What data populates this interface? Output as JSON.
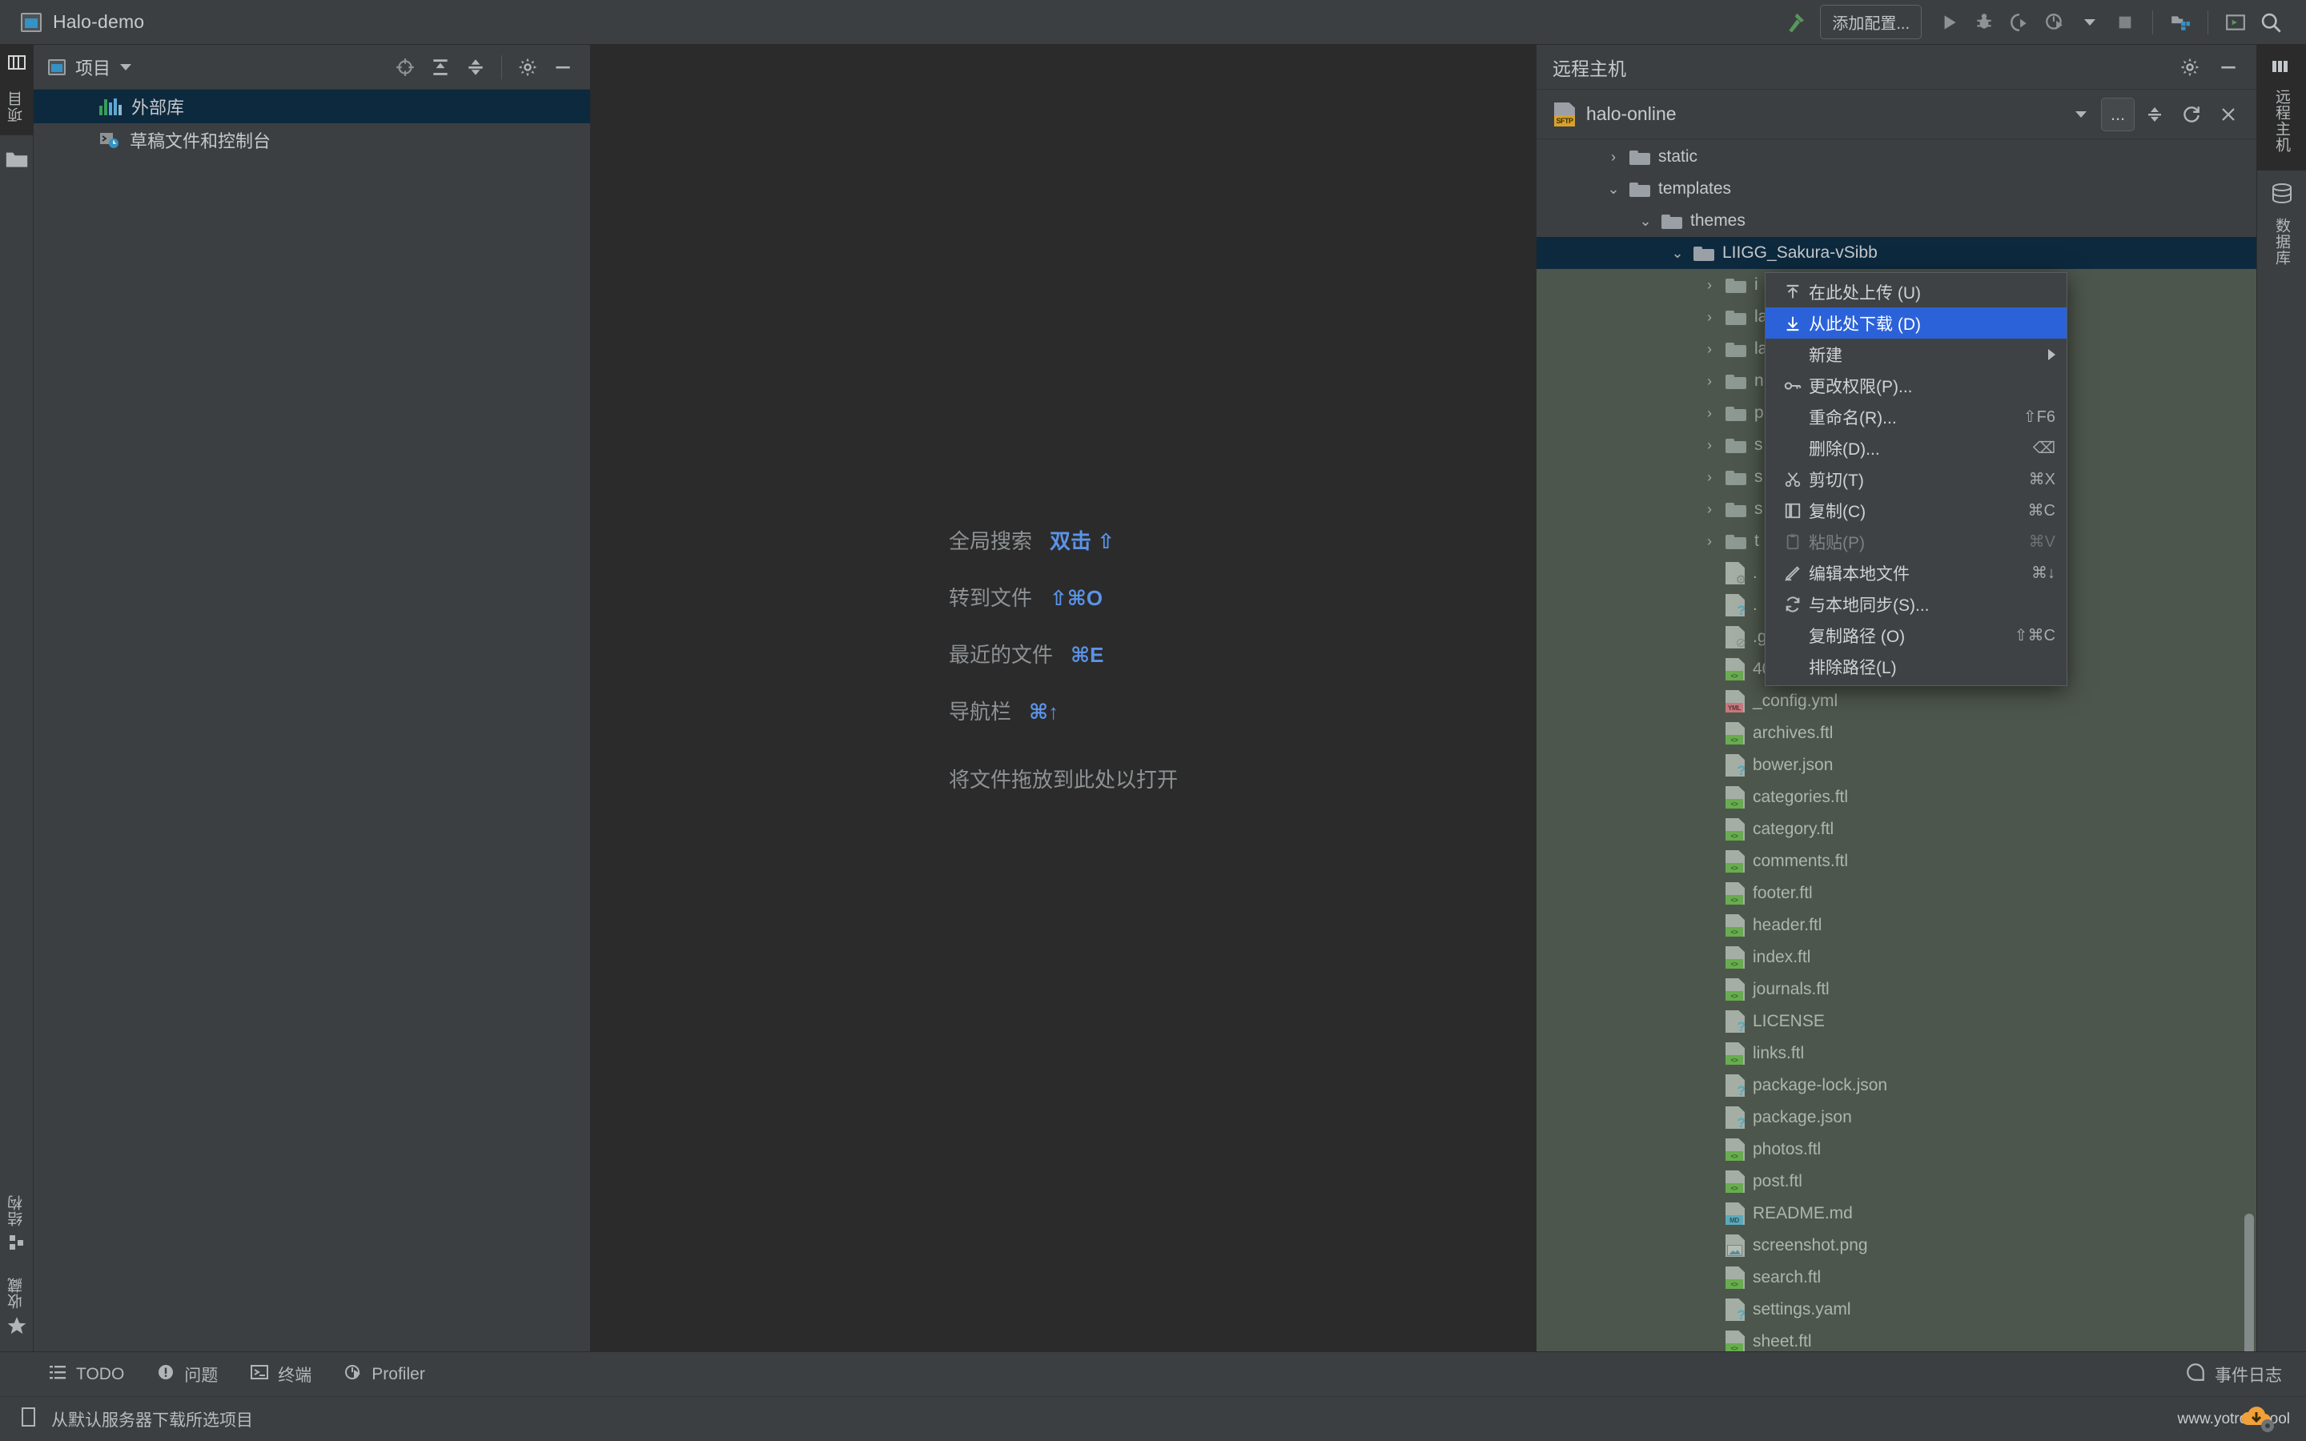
{
  "titlebar": {
    "project_name": "Halo-demo",
    "run_config_label": "添加配置...",
    "icons": [
      "hammer-icon",
      "run-icon",
      "debug-icon",
      "run-coverage-icon",
      "profile-icon",
      "dropdown-icon",
      "stop-icon",
      "git-icon",
      "terminal-icon",
      "search-everywhere-icon"
    ]
  },
  "left_strip": {
    "top_labels": [
      "项目"
    ],
    "bottom_items": [
      {
        "label": "结构",
        "icon": "structure-icon"
      },
      {
        "label": "收藏",
        "icon": "star-icon"
      }
    ],
    "folder_icon": "folder-icon"
  },
  "project_panel": {
    "title": "项目",
    "toolbar_icons": [
      "select-opened-file-icon",
      "expand-all-icon",
      "collapse-all-icon",
      "gear-icon",
      "hide-icon"
    ],
    "tree": [
      {
        "label": "外部库",
        "icon": "library-bars-icon",
        "selected": true
      },
      {
        "label": "草稿文件和控制台",
        "icon": "scratches-icon",
        "selected": false
      }
    ]
  },
  "editor": {
    "hints": [
      {
        "action": "全局搜索",
        "keys": "双击 ⇧"
      },
      {
        "action": "转到文件",
        "keys": "⇧⌘O"
      },
      {
        "action": "最近的文件",
        "keys": "⌘E"
      },
      {
        "action": "导航栏",
        "keys": "⌘↑"
      }
    ],
    "drop_hint": "将文件拖放到此处以打开"
  },
  "remote_panel": {
    "title": "远程主机",
    "header_icons": [
      "gear-icon",
      "hide-icon"
    ],
    "connection": "halo-online",
    "connection_icon": "sftp-icon",
    "toolbar_icons": [
      "dropdown-icon",
      "more-icon",
      "collapse-all-icon",
      "refresh-icon",
      "close-icon"
    ],
    "more_label": "...",
    "tree": [
      {
        "name": "static",
        "type": "folder",
        "chevron": "›",
        "indent": 1,
        "selected": false
      },
      {
        "name": "templates",
        "type": "folder",
        "chevron": "⌄",
        "indent": 1,
        "selected": false
      },
      {
        "name": "themes",
        "type": "folder",
        "chevron": "⌄",
        "indent": 2,
        "selected": false
      },
      {
        "name": "LIIGG_Sakura-vSibb",
        "type": "folder",
        "chevron": "⌄",
        "indent": 3,
        "selected": true
      },
      {
        "name": "i",
        "type": "folder",
        "chevron": "›",
        "indent": 4,
        "selected": false
      },
      {
        "name": "la",
        "type": "folder",
        "chevron": "›",
        "indent": 4,
        "selected": false
      },
      {
        "name": "la",
        "type": "folder",
        "chevron": "›",
        "indent": 4,
        "selected": false
      },
      {
        "name": "n",
        "type": "folder",
        "chevron": "›",
        "indent": 4,
        "selected": false
      },
      {
        "name": "p",
        "type": "folder",
        "chevron": "›",
        "indent": 4,
        "selected": false
      },
      {
        "name": "s",
        "type": "folder",
        "chevron": "›",
        "indent": 4,
        "selected": false
      },
      {
        "name": "s",
        "type": "folder",
        "chevron": "›",
        "indent": 4,
        "selected": false
      },
      {
        "name": "s",
        "type": "folder",
        "chevron": "›",
        "indent": 4,
        "selected": false
      },
      {
        "name": "t",
        "type": "folder",
        "chevron": "›",
        "indent": 4,
        "selected": false
      },
      {
        "name": ".",
        "type": "file",
        "badge": "config",
        "indent": 4,
        "selected": false
      },
      {
        "name": ".",
        "type": "file",
        "badge": "unknown",
        "indent": 4,
        "selected": false
      },
      {
        "name": ".g",
        "type": "file",
        "badge": "ignore",
        "indent": 4,
        "selected": false
      },
      {
        "name": "404.ftl",
        "type": "file",
        "badge": "ftl",
        "indent": 4,
        "selected": false
      },
      {
        "name": "_config.yml",
        "type": "file",
        "badge": "yml",
        "indent": 4,
        "selected": false
      },
      {
        "name": "archives.ftl",
        "type": "file",
        "badge": "ftl",
        "indent": 4,
        "selected": false
      },
      {
        "name": "bower.json",
        "type": "file",
        "badge": "unknown",
        "indent": 4,
        "selected": false
      },
      {
        "name": "categories.ftl",
        "type": "file",
        "badge": "ftl",
        "indent": 4,
        "selected": false
      },
      {
        "name": "category.ftl",
        "type": "file",
        "badge": "ftl",
        "indent": 4,
        "selected": false
      },
      {
        "name": "comments.ftl",
        "type": "file",
        "badge": "ftl",
        "indent": 4,
        "selected": false
      },
      {
        "name": "footer.ftl",
        "type": "file",
        "badge": "ftl",
        "indent": 4,
        "selected": false
      },
      {
        "name": "header.ftl",
        "type": "file",
        "badge": "ftl",
        "indent": 4,
        "selected": false
      },
      {
        "name": "index.ftl",
        "type": "file",
        "badge": "ftl",
        "indent": 4,
        "selected": false
      },
      {
        "name": "journals.ftl",
        "type": "file",
        "badge": "ftl",
        "indent": 4,
        "selected": false
      },
      {
        "name": "LICENSE",
        "type": "file",
        "badge": "unknown",
        "indent": 4,
        "selected": false
      },
      {
        "name": "links.ftl",
        "type": "file",
        "badge": "ftl",
        "indent": 4,
        "selected": false
      },
      {
        "name": "package-lock.json",
        "type": "file",
        "badge": "unknown",
        "indent": 4,
        "selected": false
      },
      {
        "name": "package.json",
        "type": "file",
        "badge": "unknown",
        "indent": 4,
        "selected": false
      },
      {
        "name": "photos.ftl",
        "type": "file",
        "badge": "ftl",
        "indent": 4,
        "selected": false
      },
      {
        "name": "post.ftl",
        "type": "file",
        "badge": "ftl",
        "indent": 4,
        "selected": false
      },
      {
        "name": "README.md",
        "type": "file",
        "badge": "md",
        "indent": 4,
        "selected": false
      },
      {
        "name": "screenshot.png",
        "type": "file",
        "badge": "png",
        "indent": 4,
        "selected": false
      },
      {
        "name": "search.ftl",
        "type": "file",
        "badge": "ftl",
        "indent": 4,
        "selected": false
      },
      {
        "name": "settings.yaml",
        "type": "file",
        "badge": "unknown",
        "indent": 4,
        "selected": false
      },
      {
        "name": "sheet.ftl",
        "type": "file",
        "badge": "ftl",
        "indent": 4,
        "selected": false
      }
    ]
  },
  "context_menu": {
    "items": [
      {
        "label": "在此处上传 (U)",
        "accel": "",
        "icon": "upload-icon",
        "state": "normal"
      },
      {
        "label": "从此处下载 (D)",
        "accel": "",
        "icon": "download-icon",
        "state": "highlight"
      },
      {
        "label": "新建",
        "accel": "",
        "icon": "",
        "state": "submenu"
      },
      {
        "label": "更改权限(P)...",
        "accel": "",
        "icon": "key-icon",
        "state": "normal"
      },
      {
        "label": "重命名(R)...",
        "accel": "⇧F6",
        "icon": "",
        "state": "normal"
      },
      {
        "label": "删除(D)...",
        "accel": "⌫",
        "icon": "",
        "state": "normal"
      },
      {
        "label": "剪切(T)",
        "accel": "⌘X",
        "icon": "scissors-icon",
        "state": "normal"
      },
      {
        "label": "复制(C)",
        "accel": "⌘C",
        "icon": "copy-icon",
        "state": "normal"
      },
      {
        "label": "粘贴(P)",
        "accel": "⌘V",
        "icon": "paste-icon",
        "state": "disabled"
      },
      {
        "label": "编辑本地文件",
        "accel": "⌘↓",
        "icon": "pencil-icon",
        "state": "normal"
      },
      {
        "label": "与本地同步(S)...",
        "accel": "",
        "icon": "sync-icon",
        "state": "normal"
      },
      {
        "label": "复制路径 (O)",
        "accel": "⇧⌘C",
        "icon": "",
        "state": "normal"
      },
      {
        "label": "排除路径(L)",
        "accel": "",
        "icon": "",
        "state": "normal"
      }
    ]
  },
  "right_strip": {
    "items": [
      {
        "label": "远程主机",
        "icon": "remote-host-icon",
        "active": true
      },
      {
        "label": "数据库",
        "icon": "database-icon",
        "active": false
      }
    ]
  },
  "bottom_bar": {
    "items": [
      {
        "label": "TODO",
        "icon": "todo-icon"
      },
      {
        "label": "问题",
        "icon": "problems-icon"
      },
      {
        "label": "终端",
        "icon": "terminal-icon"
      },
      {
        "label": "Profiler",
        "icon": "profiler-icon"
      }
    ],
    "right": {
      "label": "事件日志",
      "icon": "event-log-icon"
    }
  },
  "status_bar": {
    "icon": "download-status-icon",
    "text": "从默认服务器下载所选项目",
    "watermark": "www.yotrow.cool"
  },
  "colors": {
    "accent_blue": "#2b62d9",
    "selection_navy": "#0d293e",
    "panel_bg": "#3c3f41",
    "editor_bg": "#2b2b2b",
    "hint_key_blue": "#5b93e8",
    "ftl_badge_green": "#62bb46",
    "yml_badge_pink": "#e8708a",
    "md_badge_blue": "#4db8e0"
  }
}
